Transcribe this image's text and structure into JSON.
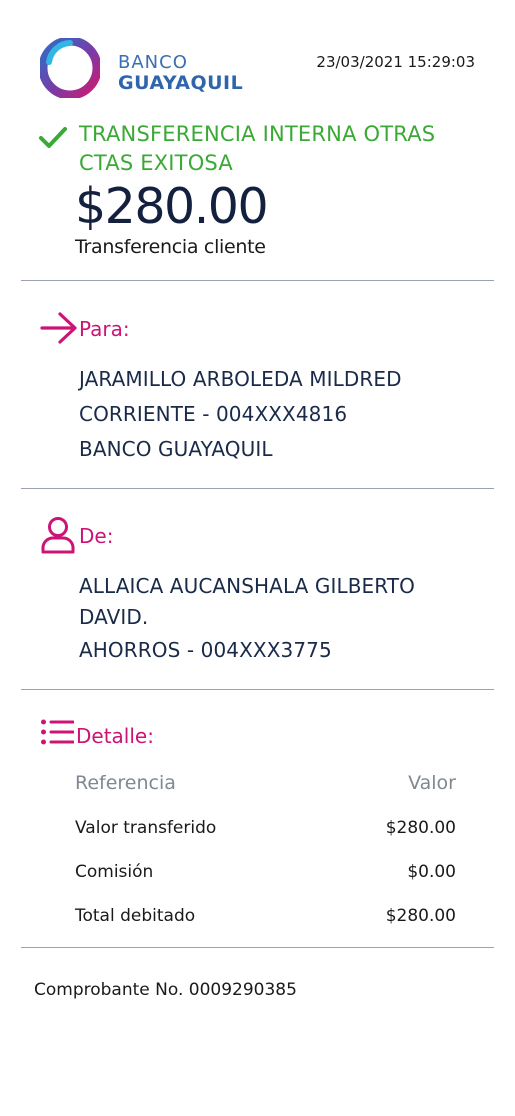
{
  "header": {
    "logo_line1": "BANCO",
    "logo_line2": "GUAYAQUIL",
    "datetime": "23/03/2021 15:29:03"
  },
  "status": {
    "title": "TRANSFERENCIA INTERNA OTRAS CTAS EXITOSA",
    "amount": "$280.00",
    "subtitle": "Transferencia cliente"
  },
  "para": {
    "title": "Para:",
    "name": "JARAMILLO ARBOLEDA MILDRED",
    "account": "CORRIENTE - 004XXX4816",
    "bank": "BANCO GUAYAQUIL"
  },
  "de": {
    "title": "De:",
    "name_line1": "ALLAICA AUCANSHALA GILBERTO",
    "name_line2": "DAVID.",
    "account": "AHORROS - 004XXX3775"
  },
  "detalle": {
    "title": "Detalle:",
    "col_reference": "Referencia",
    "col_value": "Valor",
    "rows": [
      {
        "label": "Valor transferido",
        "value": "$280.00"
      },
      {
        "label": "Comisión",
        "value": "$0.00"
      },
      {
        "label": "Total debitado",
        "value": "$280.00"
      }
    ]
  },
  "footer": {
    "receipt": "Comprobante No. 0009290385"
  },
  "icons": {
    "logo": "banco-guayaquil-logo",
    "status": "check-icon",
    "para": "arrow-right-icon",
    "de": "user-icon",
    "detalle": "list-icon"
  },
  "colors": {
    "success": "#3aa935",
    "accent": "#cc1477",
    "brand_blue": "#2f66ab",
    "text_dark": "#13213f"
  }
}
